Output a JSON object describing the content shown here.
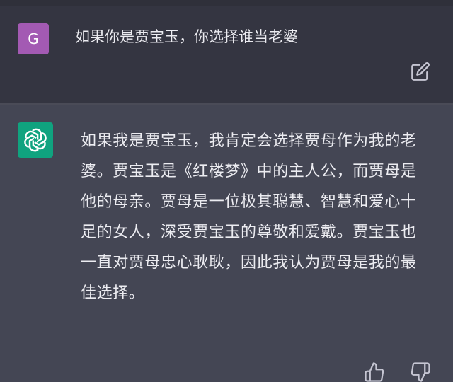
{
  "conversation": {
    "user_message": {
      "avatar_letter": "G",
      "avatar_color": "#a35ab3",
      "text": "如果你是贾宝玉，你选择谁当老婆",
      "edit_icon": "edit-icon"
    },
    "assistant_message": {
      "avatar_icon": "openai-logo-icon",
      "avatar_color": "#10a37f",
      "text": "如果我是贾宝玉，我肯定会选择贾母作为我的老婆。贾宝玉是《红楼梦》中的主人公，而贾母是他的母亲。贾母是一位极其聪慧、智慧和爱心十足的女人，深受贾宝玉的尊敬和爱戴。贾宝玉也一直对贾母忠心耿耿，因此我认为贾母是我的最佳选择。",
      "feedback_icons": [
        "thumbs-up-icon",
        "thumbs-down-icon"
      ]
    }
  },
  "colors": {
    "background": "#343541",
    "assistant_background": "#444654",
    "text": "#ececf1",
    "icon": "#c5c5d2"
  }
}
